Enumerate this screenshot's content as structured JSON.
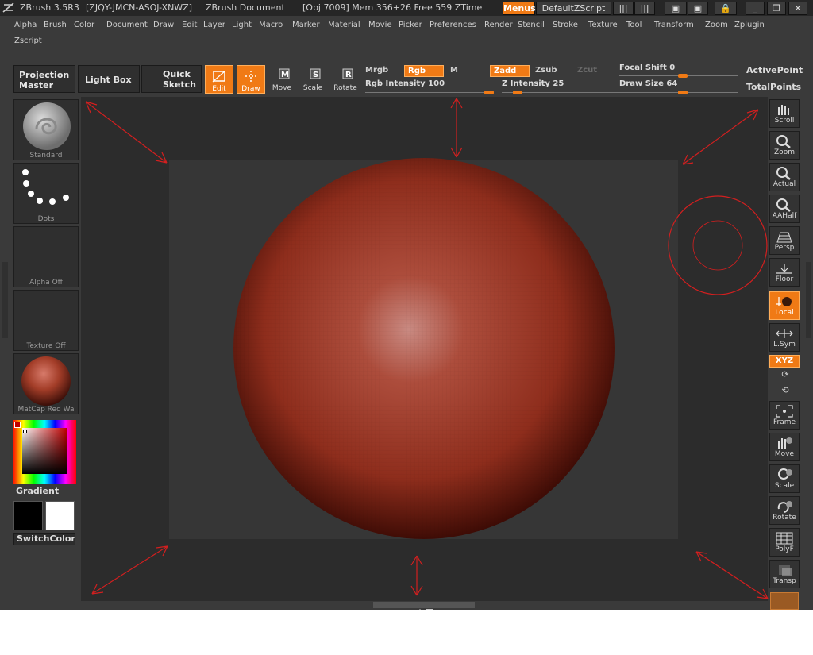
{
  "titlebar": {
    "app": "ZBrush 3.5R3",
    "serial": "[ZJQY-JMCN-ASOJ-XNWZ]",
    "document": "ZBrush Document",
    "stats": "[Obj 7009] Mem 356+26 Free 559 ZTime",
    "menus_button": "Menus",
    "script_button": "DefaultZScript"
  },
  "menubar": {
    "items": [
      "Alpha",
      "Brush",
      "Color",
      "Document",
      "Draw",
      "Edit",
      "Layer",
      "Light",
      "Macro",
      "Marker",
      "Material",
      "Movie",
      "Picker",
      "Preferences",
      "Render",
      "Stencil",
      "Stroke",
      "Texture",
      "Tool",
      "Transform",
      "Zoom",
      "Zplugin",
      "Zscript"
    ]
  },
  "toolbar": {
    "projection_master": [
      "Projection",
      "Master"
    ],
    "light_box": "Light Box",
    "quick_sketch": [
      "Quick",
      "Sketch"
    ],
    "edit": "Edit",
    "draw": "Draw",
    "move": "Move",
    "scale": "Scale",
    "rotate": "Rotate",
    "mrgb": "Mrgb",
    "rgb": "Rgb",
    "m": "M",
    "zadd": "Zadd",
    "zsub": "Zsub",
    "zcut": "Zcut",
    "rgb_intensity_label": "Rgb Intensity 100",
    "rgb_intensity_value": 1.0,
    "z_intensity_label": "Z Intensity 25",
    "z_intensity_value": 0.25,
    "focal_shift_label": "Focal Shift 0",
    "focal_shift_value": 0.0,
    "draw_size_label": "Draw Size 64",
    "draw_size_value": 0.064,
    "active_points": "ActivePoint",
    "total_points": "TotalPoints"
  },
  "leftshelf": {
    "brush": "Standard",
    "stroke": "Dots",
    "alpha": "Alpha Off",
    "texture": "Texture Off",
    "material": "MatCap Red Wa",
    "gradient": "Gradient",
    "switchcolor": "SwitchColor"
  },
  "rightshelf": {
    "scroll": "Scroll",
    "zoom": "Zoom",
    "actual": "Actual",
    "aahalf": "AAHalf",
    "persp": "Persp",
    "floor": "Floor",
    "local": "Local",
    "lsym": "L.Sym",
    "xyz": "XYZ",
    "frame": "Frame",
    "move": "Move",
    "scale": "Scale",
    "rotate": "Rotate",
    "polyf": "PolyF",
    "transp": "Transp"
  },
  "colors": {
    "accent": "#f07a15",
    "sphere": "#a33d28",
    "annotation": "#d31f1f"
  }
}
